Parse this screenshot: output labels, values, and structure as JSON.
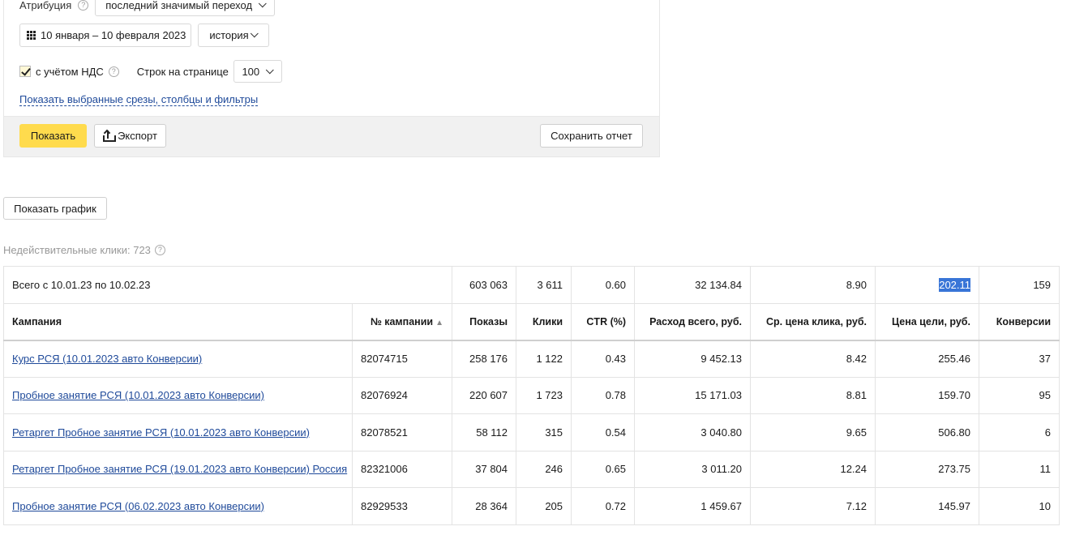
{
  "filters": {
    "attribution_label": "Атрибуция",
    "attribution_value": "последний значимый переход",
    "date_range": "10 января – 10 февраля 2023",
    "history_label": "история",
    "nds_label": "с учётом НДС",
    "rows_per_page_label": "Строк на странице",
    "rows_per_page_value": "100",
    "show_filters_link": "Показать выбранные срезы, столбцы и фильтры"
  },
  "actions": {
    "show": "Показать",
    "export": "Экспорт",
    "save_report": "Сохранить отчет",
    "show_chart": "Показать график"
  },
  "invalid_clicks": "Недействительные клики: 723",
  "table": {
    "totals": {
      "label": "Всего с 10.01.23 по 10.02.23",
      "impressions": "603 063",
      "clicks": "3 611",
      "ctr": "0.60",
      "spend": "32 134.84",
      "avg_cpc": "8.90",
      "cost_per_goal": "202.11",
      "conversions": "159"
    },
    "headers": {
      "campaign": "Кампания",
      "campaign_no": "№ кампании",
      "impressions": "Показы",
      "clicks": "Клики",
      "ctr": "CTR (%)",
      "spend": "Расход всего, руб.",
      "avg_cpc": "Ср. цена клика, руб.",
      "cost_per_goal": "Цена цели, руб.",
      "conversions": "Конверсии"
    },
    "rows": [
      {
        "campaign": "Курс РСЯ (10.01.2023 авто Конверсии)",
        "id": "82074715",
        "impressions": "258 176",
        "clicks": "1 122",
        "ctr": "0.43",
        "spend": "9 452.13",
        "avg_cpc": "8.42",
        "cost_per_goal": "255.46",
        "conversions": "37"
      },
      {
        "campaign": "Пробное занятие РСЯ (10.01.2023 авто Конверсии)",
        "id": "82076924",
        "impressions": "220 607",
        "clicks": "1 723",
        "ctr": "0.78",
        "spend": "15 171.03",
        "avg_cpc": "8.81",
        "cost_per_goal": "159.70",
        "conversions": "95"
      },
      {
        "campaign": "Ретаргет Пробное занятие РСЯ (10.01.2023 авто Конверсии)",
        "id": "82078521",
        "impressions": "58 112",
        "clicks": "315",
        "ctr": "0.54",
        "spend": "3 040.80",
        "avg_cpc": "9.65",
        "cost_per_goal": "506.80",
        "conversions": "6"
      },
      {
        "campaign": "Ретаргет Пробное занятие РСЯ (19.01.2023 авто Конверсии) Россия",
        "id": "82321006",
        "impressions": "37 804",
        "clicks": "246",
        "ctr": "0.65",
        "spend": "3 011.20",
        "avg_cpc": "12.24",
        "cost_per_goal": "273.75",
        "conversions": "11"
      },
      {
        "campaign": "Пробное занятие РСЯ (06.02.2023 авто Конверсии)",
        "id": "82929533",
        "impressions": "28 364",
        "clicks": "205",
        "ctr": "0.72",
        "spend": "1 459.67",
        "avg_cpc": "7.12",
        "cost_per_goal": "145.97",
        "conversions": "10"
      }
    ]
  }
}
